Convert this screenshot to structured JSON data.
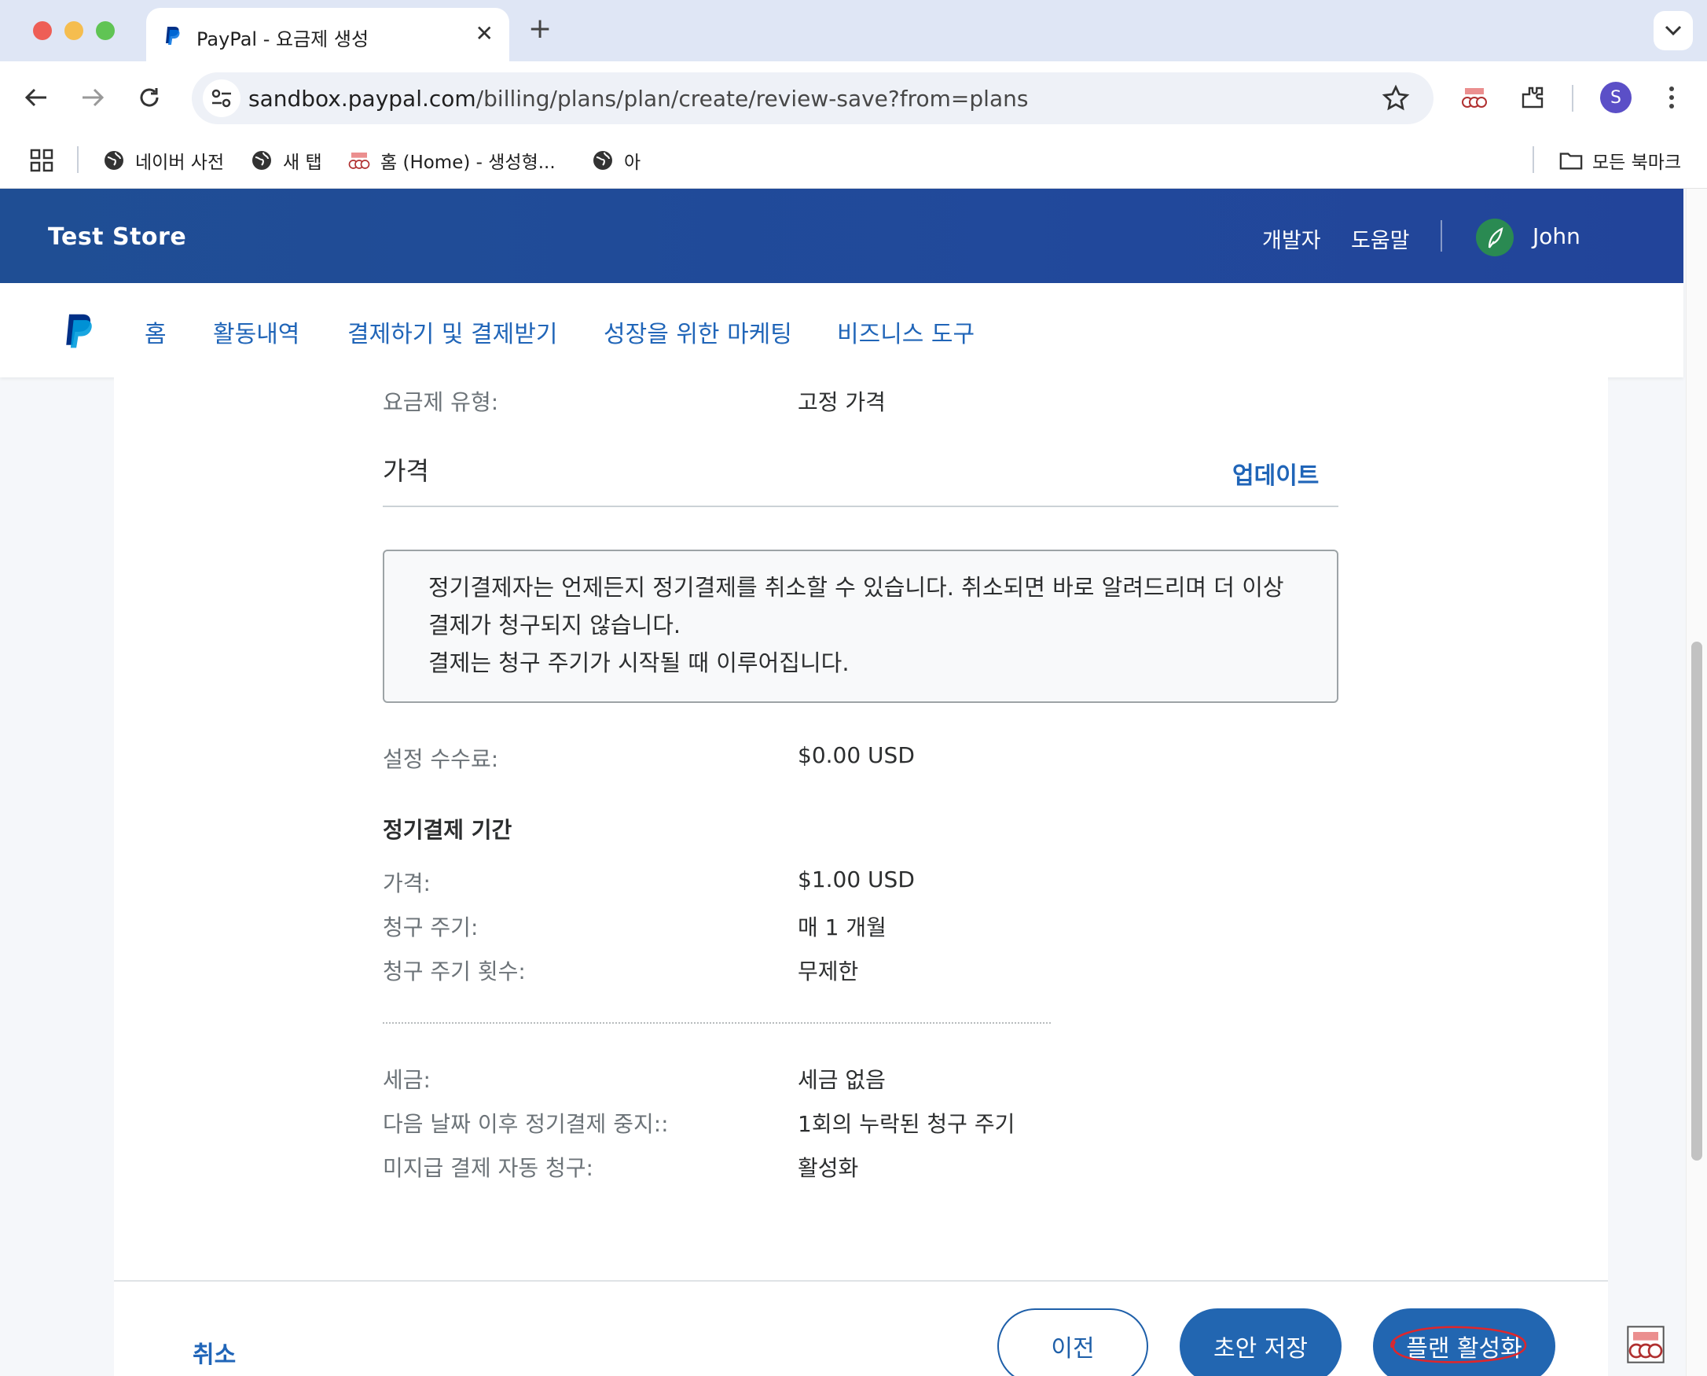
{
  "browser": {
    "tab_title": "PayPal - 요금제 생성",
    "tab_close": "✕",
    "new_tab": "+",
    "url_host": "sandbox.paypal.com",
    "url_path": "/billing/plans/plan/create/review-save?from=plans",
    "profile_initial": "S",
    "bookmarks": [
      {
        "label": "네이버 사전"
      },
      {
        "label": "새 탭"
      },
      {
        "label": "홈 (Home) - 생성형..."
      },
      {
        "label": "아"
      }
    ],
    "all_bookmarks": "모든 북마크"
  },
  "header": {
    "store_name": "Test Store",
    "developer": "개발자",
    "help": "도움말",
    "user_name": "John"
  },
  "nav": {
    "items": [
      {
        "label": "홈"
      },
      {
        "label": "활동내역"
      },
      {
        "label": "결제하기 및 결제받기"
      },
      {
        "label": "성장을 위한 마케팅"
      },
      {
        "label": "비즈니스 도구"
      }
    ]
  },
  "plan": {
    "plan_type_label": "요금제 유형:",
    "plan_type_value": "고정 가격",
    "pricing_title": "가격",
    "update_link": "업데이트",
    "notice_line1": "정기결제자는 언제든지 정기결제를 취소할 수 있습니다. 취소되면 바로 알려드리며 더 이상 결제가 청구되지 않습니다.",
    "notice_line2": "결제는 청구 주기가 시작될 때 이루어집니다.",
    "setup_fee_label": "설정 수수료:",
    "setup_fee_value": "$0.00 USD",
    "subscription_period_title": "정기결제 기간",
    "price_label": "가격:",
    "price_value": "$1.00 USD",
    "billing_cycle_label": "청구 주기:",
    "billing_cycle_value": "매 1 개월",
    "cycle_count_label": "청구 주기 횟수:",
    "cycle_count_value": "무제한",
    "tax_label": "세금:",
    "tax_value": "세금 없음",
    "stop_after_label": "다음 날짜 이후 정기결제 중지::",
    "stop_after_value": "1회의 누락된 청구 주기",
    "auto_bill_label": "미지급 결제 자동 청구:",
    "auto_bill_value": "활성화"
  },
  "footer": {
    "cancel": "취소",
    "previous": "이전",
    "save_draft": "초안 저장",
    "activate": "플랜 활성화"
  },
  "colors": {
    "paypal_blue": "#2065b8",
    "header_blue": "#21499b",
    "annotation_red": "#e0262b"
  }
}
